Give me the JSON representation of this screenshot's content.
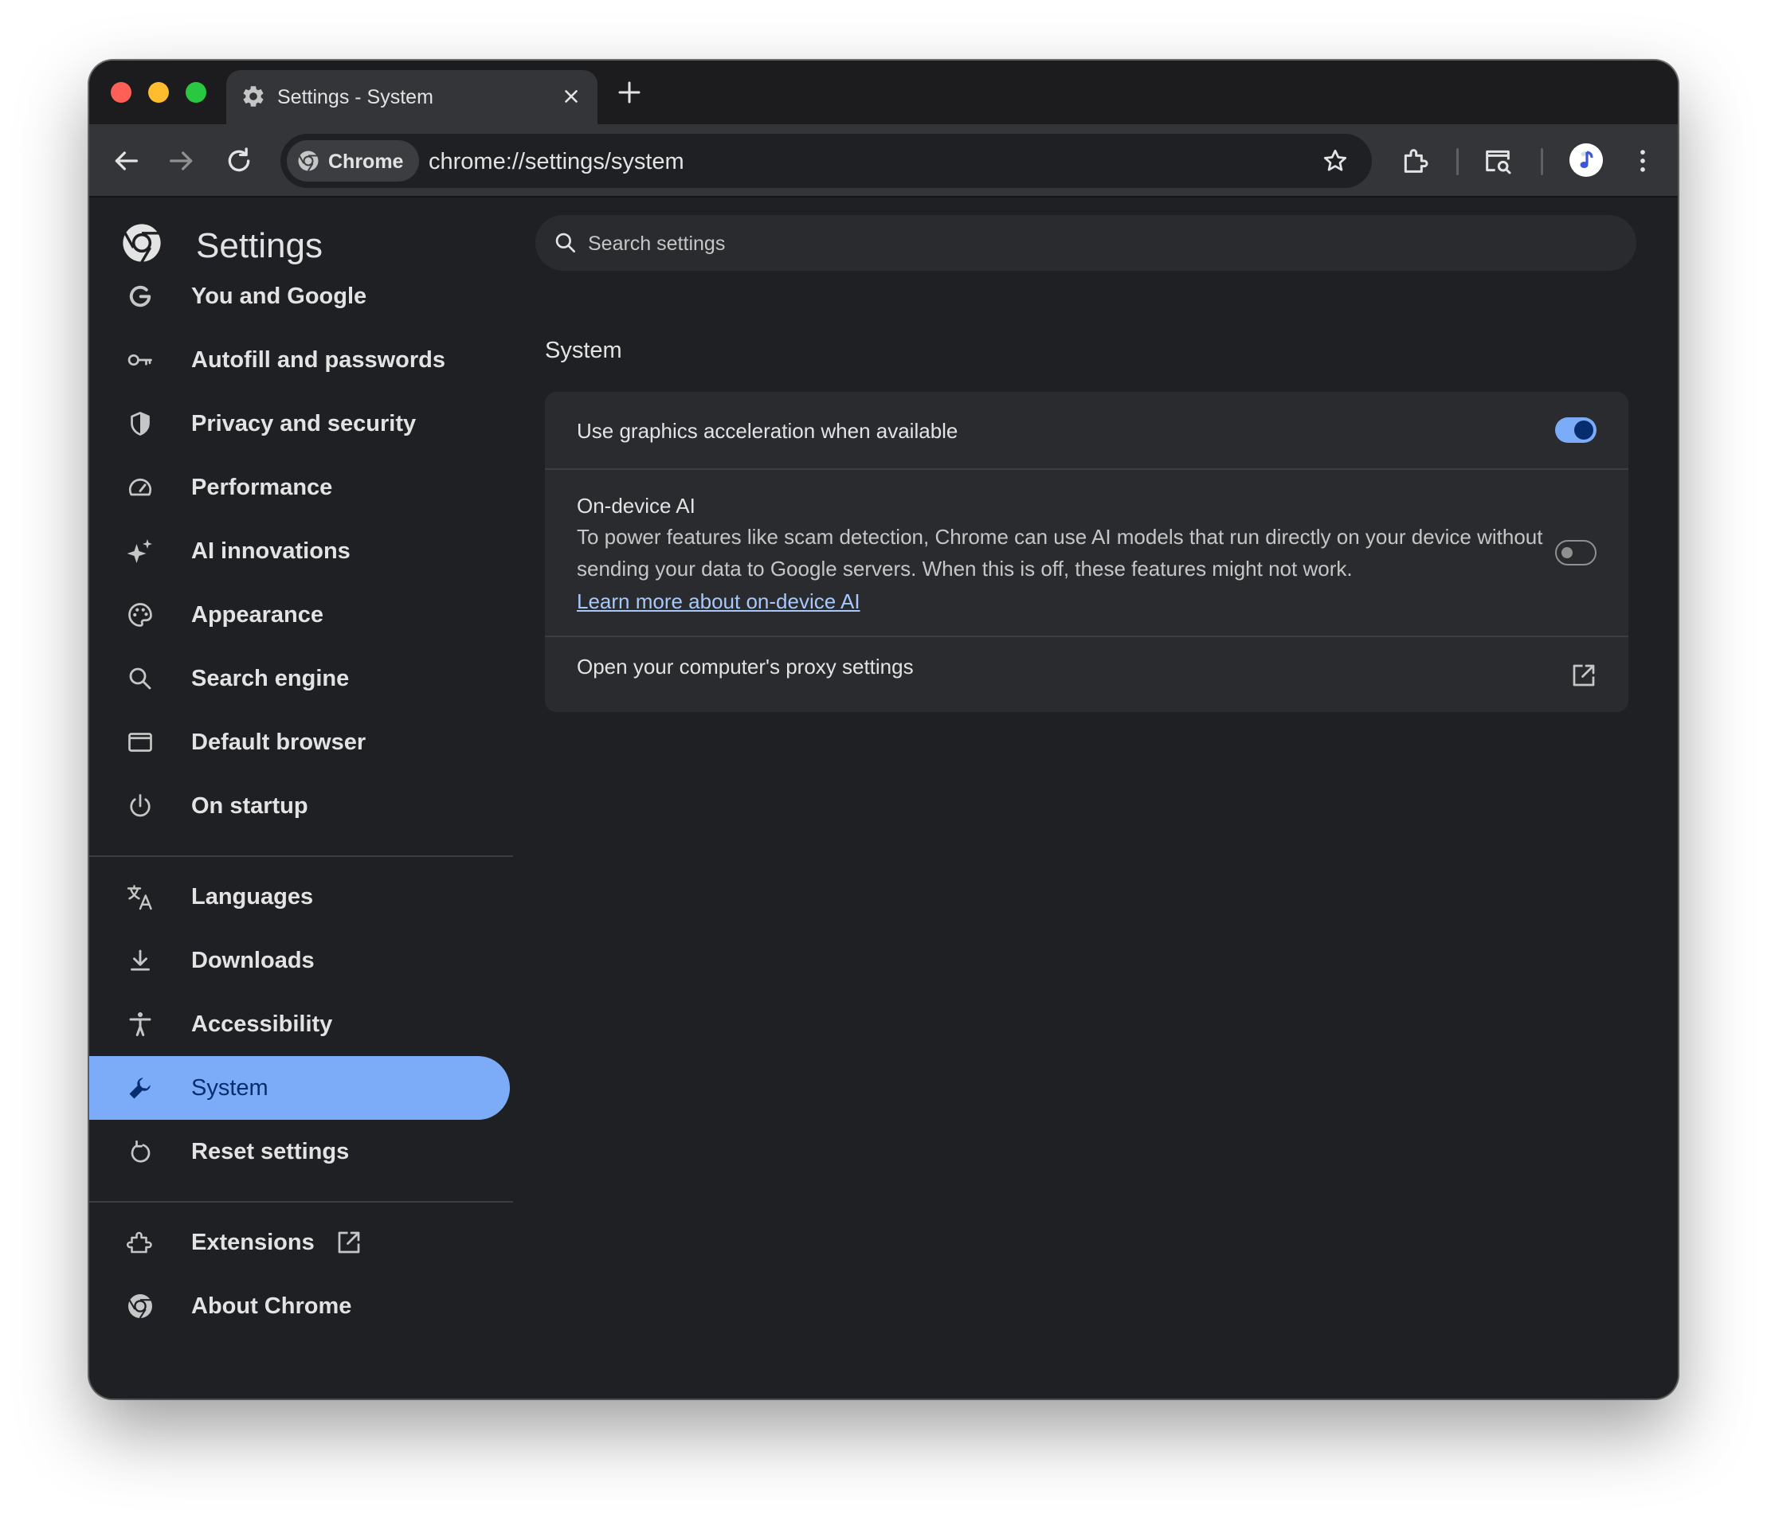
{
  "tab": {
    "title": "Settings - System",
    "icon": "gear-icon"
  },
  "toolbar": {
    "chip_label": "Chrome",
    "url": "chrome://settings/system"
  },
  "sidebar": {
    "title": "Settings",
    "items": [
      {
        "label": "You and Google",
        "icon": "google-g-icon"
      },
      {
        "label": "Autofill and passwords",
        "icon": "key-icon"
      },
      {
        "label": "Privacy and security",
        "icon": "shield-icon"
      },
      {
        "label": "Performance",
        "icon": "speedometer-icon"
      },
      {
        "label": "AI innovations",
        "icon": "sparkle-icon"
      },
      {
        "label": "Appearance",
        "icon": "palette-icon"
      },
      {
        "label": "Search engine",
        "icon": "search-icon"
      },
      {
        "label": "Default browser",
        "icon": "browser-window-icon"
      },
      {
        "label": "On startup",
        "icon": "power-icon"
      },
      {
        "label": "Languages",
        "icon": "translate-icon"
      },
      {
        "label": "Downloads",
        "icon": "download-icon"
      },
      {
        "label": "Accessibility",
        "icon": "accessibility-icon"
      },
      {
        "label": "System",
        "icon": "wrench-icon",
        "selected": true
      },
      {
        "label": "Reset settings",
        "icon": "reset-icon"
      },
      {
        "label": "Extensions",
        "icon": "puzzle-icon"
      },
      {
        "label": "About Chrome",
        "icon": "chrome-logo-icon"
      }
    ]
  },
  "search": {
    "placeholder": "Search settings"
  },
  "main": {
    "section_title": "System",
    "graphics": {
      "label": "Use graphics acceleration when available",
      "enabled": true
    },
    "ondevice": {
      "label": "On-device AI",
      "description": "To power features like scam detection, Chrome can use AI models that run directly on your device without sending your data to Google servers. When this is off, these features might not work.",
      "link": "Learn more about on-device AI",
      "enabled": false
    },
    "proxy": {
      "label": "Open your computer's proxy settings"
    }
  },
  "colors": {
    "accent": "#7cacf8",
    "background": "#1f2023",
    "card": "#2a2b2e",
    "toolbar": "#343539",
    "link": "#a8c7fa"
  }
}
